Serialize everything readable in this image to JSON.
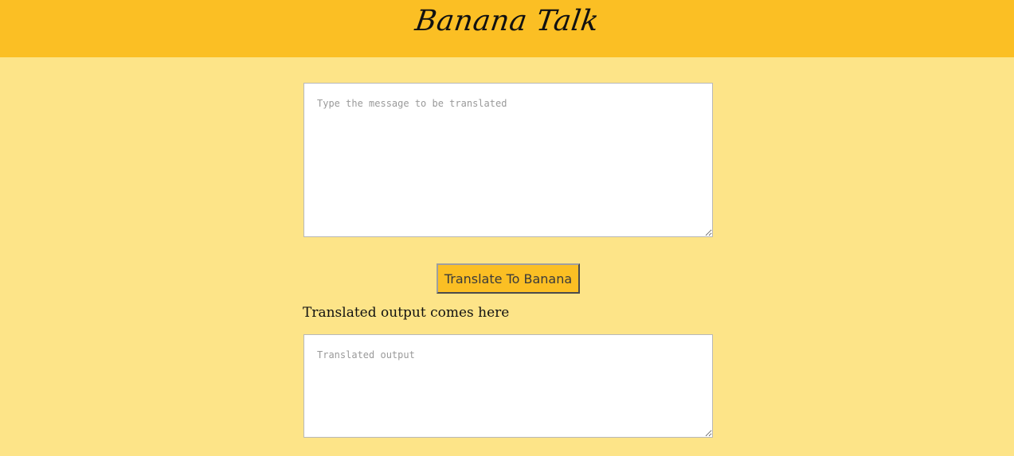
{
  "header": {
    "title": "Banana Talk",
    "background": "#fbbf24"
  },
  "page": {
    "background": "#fde488"
  },
  "translator": {
    "input_placeholder": "Type the message to be translated",
    "input_value": "",
    "translate_button_label": "Translate To Banana",
    "output_heading": "Translated output comes here",
    "output_placeholder": "Translated output",
    "output_value": ""
  },
  "icons": {
    "resize_handle": "resize-grip-icon"
  }
}
